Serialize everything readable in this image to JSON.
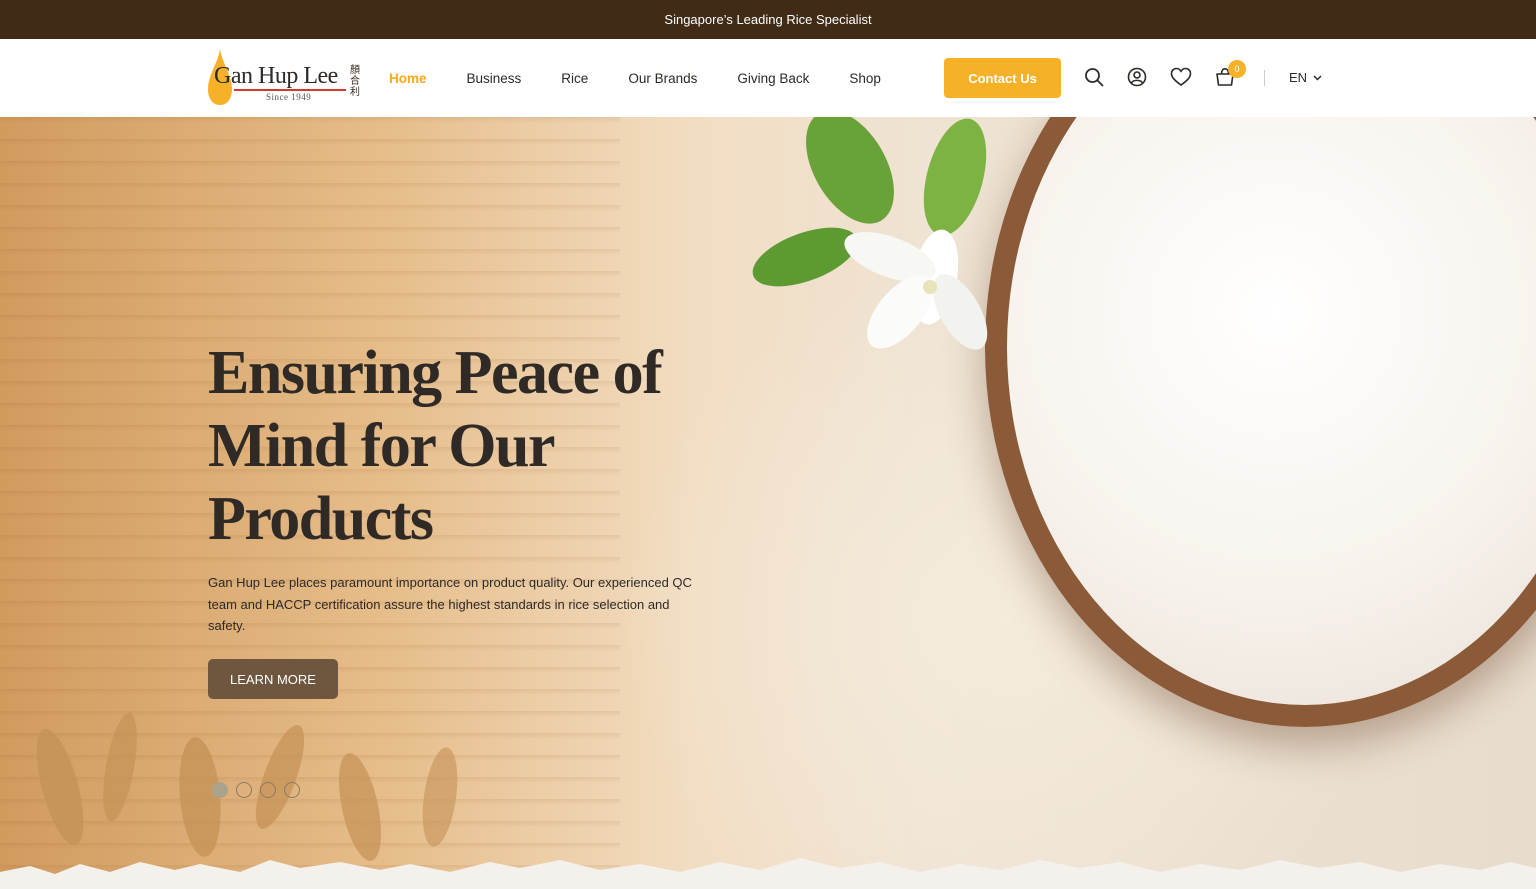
{
  "topbar": {
    "text": "Singapore’s Leading Rice Specialist"
  },
  "logo": {
    "name": "Gan Hup Lee",
    "since": "Since 1949",
    "chinese": "顏合利"
  },
  "nav": [
    {
      "label": "Home",
      "active": true
    },
    {
      "label": "Business",
      "active": false
    },
    {
      "label": "Rice",
      "active": false
    },
    {
      "label": "Our Brands",
      "active": false
    },
    {
      "label": "Giving Back",
      "active": false
    },
    {
      "label": "Shop",
      "active": false
    }
  ],
  "header": {
    "contact_label": "Contact Us",
    "cart_count": "0",
    "language": "EN",
    "icons": [
      "search-icon",
      "account-icon",
      "heart-icon",
      "cart-icon",
      "chevron-down-icon"
    ]
  },
  "hero": {
    "headline": "Ensuring Peace of Mind for Our Products",
    "description": "Gan Hup Lee places paramount importance on product quality. Our experienced QC team and HACCP certification assure the highest standards in rice selection and safety.",
    "button_label": "LEARN MORE",
    "slides_total": 4,
    "active_slide": 1
  },
  "colors": {
    "topbar": "#412b17",
    "accent": "#f7b129",
    "button": "#6e563f",
    "text": "#2d2a27"
  }
}
